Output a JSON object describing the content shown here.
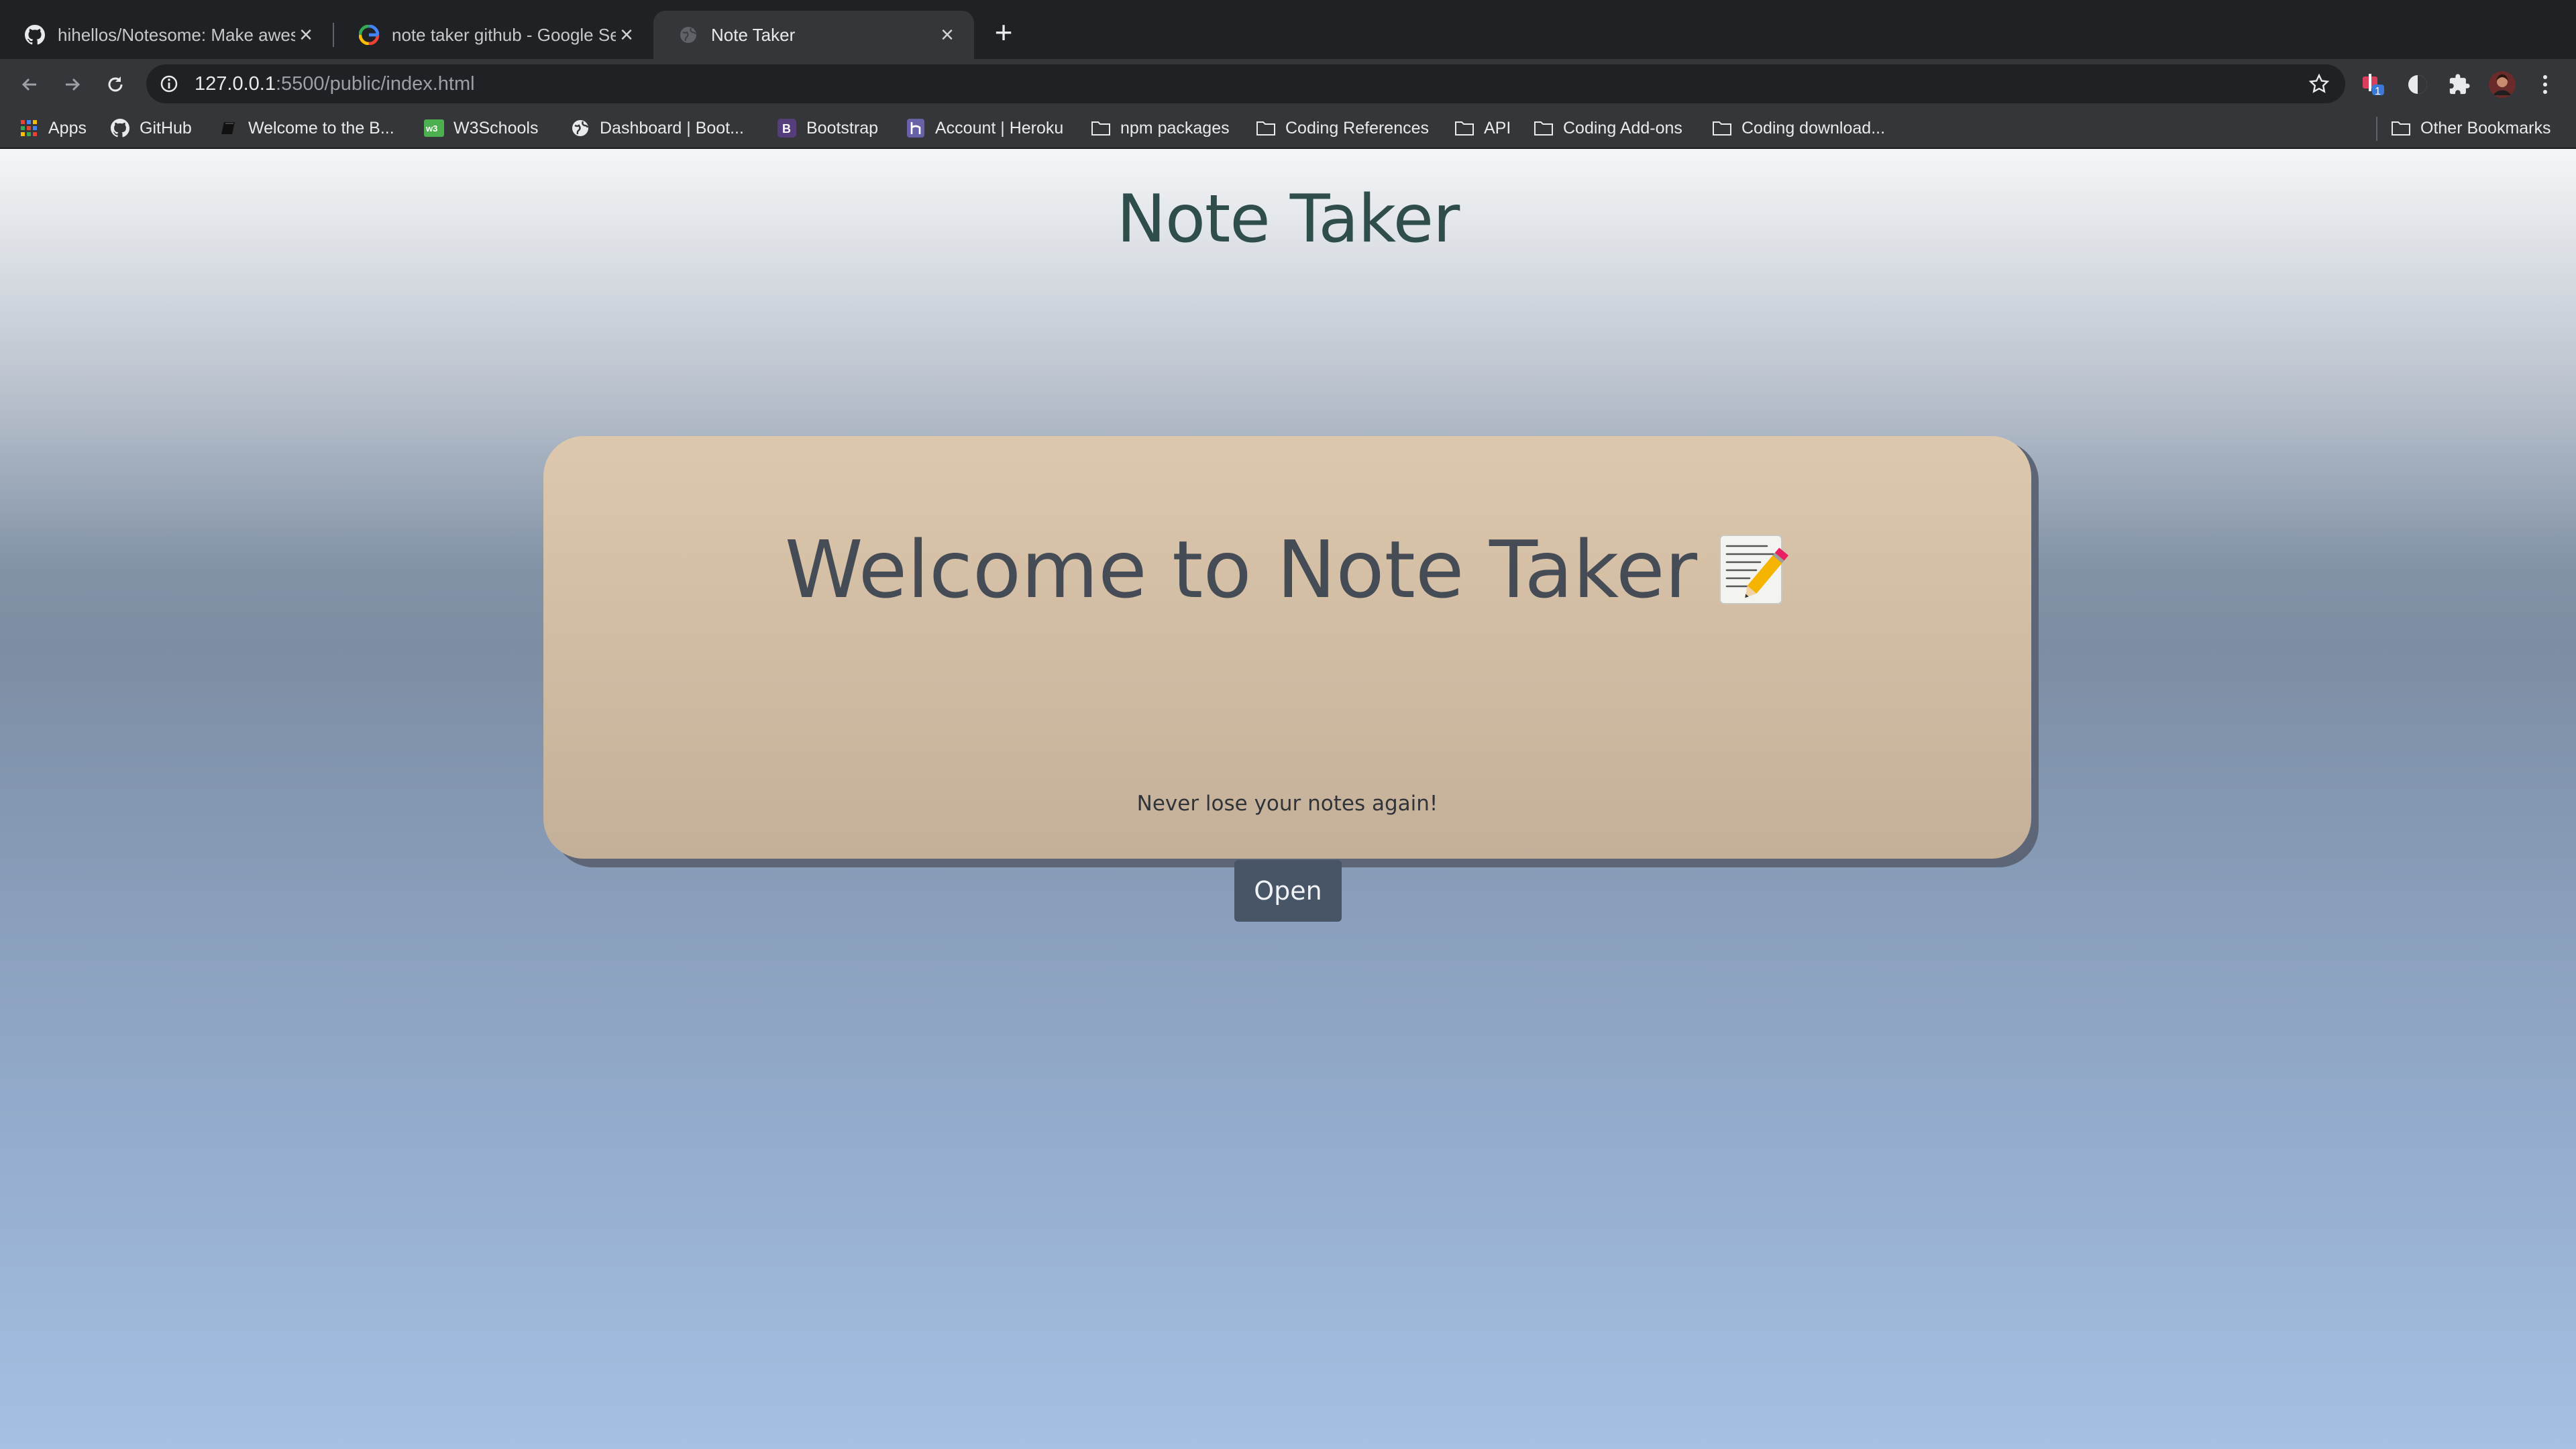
{
  "browser": {
    "tabs": [
      {
        "title": "hihellos/Notesome: Make awes",
        "favicon": "github-icon",
        "active": false
      },
      {
        "title": "note taker github - Google Sea",
        "favicon": "google-icon",
        "active": false
      },
      {
        "title": "Note Taker",
        "favicon": "globe-icon",
        "active": true
      }
    ],
    "url_host": "127.0.0.1",
    "url_rest": ":5500/public/index.html",
    "bookmarks": [
      {
        "label": "Apps",
        "icon": "apps-grid-icon"
      },
      {
        "label": "GitHub",
        "icon": "github-icon"
      },
      {
        "label": "Welcome to the B...",
        "icon": "book-icon"
      },
      {
        "label": "W3Schools",
        "icon": "w3schools-icon"
      },
      {
        "label": "Dashboard | Boot...",
        "icon": "globe-icon"
      },
      {
        "label": "Bootstrap",
        "icon": "bootstrap-icon"
      },
      {
        "label": "Account | Heroku",
        "icon": "heroku-icon"
      },
      {
        "label": "npm packages",
        "icon": "folder-icon"
      },
      {
        "label": "Coding References",
        "icon": "folder-icon"
      },
      {
        "label": "API",
        "icon": "folder-icon"
      },
      {
        "label": "Coding Add-ons",
        "icon": "folder-icon"
      },
      {
        "label": "Coding download...",
        "icon": "folder-icon"
      },
      {
        "label": "Other Bookmarks",
        "icon": "folder-icon"
      }
    ],
    "extension_badge": "1"
  },
  "page": {
    "title": "Note Taker",
    "welcome": "Welcome to Note Taker",
    "tagline": "Never lose your notes again!",
    "open_label": "Open"
  },
  "colors": {
    "title": "#2e4d4b",
    "card": "#d6c2a8",
    "button": "#475567"
  }
}
